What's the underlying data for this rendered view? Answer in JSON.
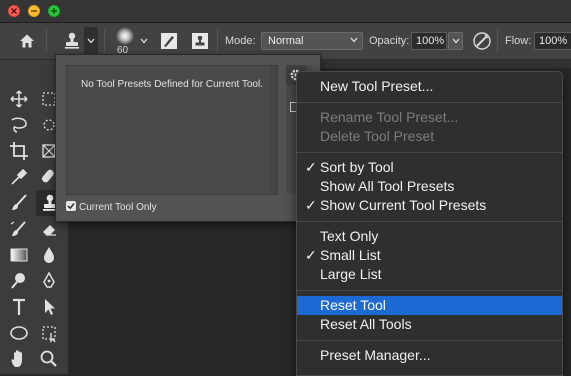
{
  "options_bar": {
    "brush_size": "60",
    "mode_label": "Mode:",
    "mode_value": "Normal",
    "opacity_label": "Opacity:",
    "opacity_value": "100%",
    "flow_label": "Flow:",
    "flow_value": "100%"
  },
  "preset_panel": {
    "message": "No Tool Presets Defined for Current Tool.",
    "current_tool_only_label": "Current Tool Only",
    "current_tool_only_checked": true
  },
  "menu": {
    "items": [
      {
        "label": "New Tool Preset...",
        "enabled": true,
        "checked": false,
        "highlighted": false
      },
      {
        "label": "Rename Tool Preset...",
        "enabled": false,
        "checked": false,
        "highlighted": false
      },
      {
        "label": "Delete Tool Preset",
        "enabled": false,
        "checked": false,
        "highlighted": false
      },
      {
        "label": "Sort by Tool",
        "enabled": true,
        "checked": true,
        "highlighted": false
      },
      {
        "label": "Show All Tool Presets",
        "enabled": true,
        "checked": false,
        "highlighted": false
      },
      {
        "label": "Show Current Tool Presets",
        "enabled": true,
        "checked": true,
        "highlighted": false
      },
      {
        "label": "Text Only",
        "enabled": true,
        "checked": false,
        "highlighted": false
      },
      {
        "label": "Small List",
        "enabled": true,
        "checked": true,
        "highlighted": false
      },
      {
        "label": "Large List",
        "enabled": true,
        "checked": false,
        "highlighted": false
      },
      {
        "label": "Reset Tool",
        "enabled": true,
        "checked": false,
        "highlighted": true
      },
      {
        "label": "Reset All Tools",
        "enabled": true,
        "checked": false,
        "highlighted": false
      },
      {
        "label": "Preset Manager...",
        "enabled": true,
        "checked": false,
        "highlighted": false
      }
    ],
    "check_glyph": "✓"
  },
  "colors": {
    "highlight": "#1d6ad4",
    "menu_bg": "#2f2f2f",
    "panel_bg": "#535353"
  }
}
